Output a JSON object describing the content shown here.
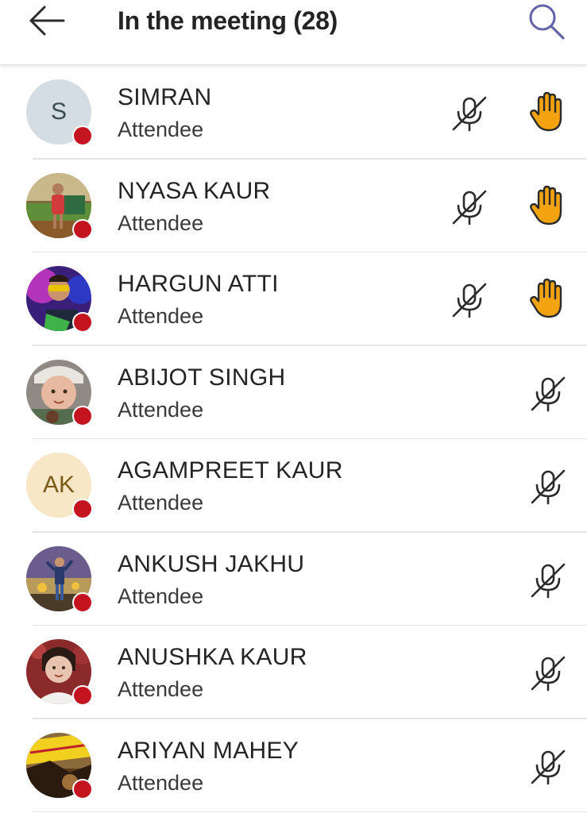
{
  "header": {
    "title": "In the meeting (28)",
    "back_icon": "arrow-left-icon",
    "search_icon": "search-icon"
  },
  "colors": {
    "accent": "#6264a7",
    "status_busy": "#c4141f",
    "hand": "#f2a30f",
    "divider": "#e4e4e4"
  },
  "participants": [
    {
      "name": "SIMRAN",
      "role": "Attendee",
      "initials": "S",
      "avatar": "initials",
      "avatar_bg": "#d3dde3",
      "initials_color": "#3d4b55",
      "mic": "muted",
      "hand_raised": true
    },
    {
      "name": "NYASA KAUR",
      "role": "Attendee",
      "avatar": "photo",
      "mic": "muted",
      "hand_raised": true
    },
    {
      "name": "HARGUN ATTI",
      "role": "Attendee",
      "avatar": "photo",
      "mic": "muted",
      "hand_raised": true
    },
    {
      "name": "ABIJOT SINGH",
      "role": "Attendee",
      "avatar": "photo",
      "mic": "muted",
      "hand_raised": false
    },
    {
      "name": "AGAMPREET KAUR",
      "role": "Attendee",
      "initials": "AK",
      "avatar": "initials",
      "avatar_bg": "#f7e7c6",
      "initials_color": "#7a5a18",
      "mic": "muted",
      "hand_raised": false
    },
    {
      "name": "ANKUSH JAKHU",
      "role": "Attendee",
      "avatar": "photo",
      "mic": "muted",
      "hand_raised": false
    },
    {
      "name": "ANUSHKA KAUR",
      "role": "Attendee",
      "avatar": "photo",
      "mic": "muted",
      "hand_raised": false
    },
    {
      "name": "ARIYAN MAHEY",
      "role": "Attendee",
      "avatar": "photo",
      "mic": "muted",
      "hand_raised": false
    }
  ]
}
